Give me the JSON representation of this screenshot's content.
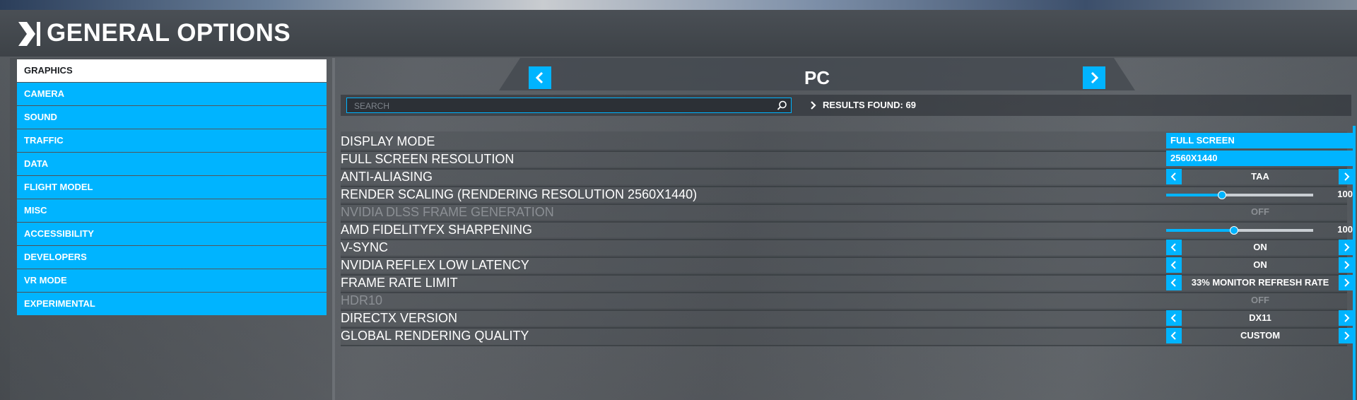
{
  "header": {
    "title": "GENERAL OPTIONS"
  },
  "sidebar": {
    "items": [
      {
        "label": "GRAPHICS",
        "active": true
      },
      {
        "label": "CAMERA"
      },
      {
        "label": "SOUND"
      },
      {
        "label": "TRAFFIC"
      },
      {
        "label": "DATA"
      },
      {
        "label": "FLIGHT MODEL"
      },
      {
        "label": "MISC"
      },
      {
        "label": "ACCESSIBILITY"
      },
      {
        "label": "DEVELOPERS"
      },
      {
        "label": "VR MODE"
      },
      {
        "label": "EXPERIMENTAL"
      }
    ]
  },
  "platform": {
    "title": "PC"
  },
  "search": {
    "placeholder": "SEARCH",
    "value": ""
  },
  "results": {
    "label": "RESULTS FOUND: 69"
  },
  "rows": [
    {
      "label": "DISPLAY MODE",
      "type": "dropdown",
      "value": "FULL SCREEN"
    },
    {
      "label": "FULL SCREEN RESOLUTION",
      "type": "dropdown",
      "value": "2560X1440"
    },
    {
      "label": "ANTI-ALIASING",
      "type": "selector",
      "value": "TAA"
    },
    {
      "label": "RENDER SCALING (RENDERING RESOLUTION 2560X1440)",
      "type": "slider",
      "value": "100",
      "fill_fraction": 0.38
    },
    {
      "label": "NVIDIA DLSS FRAME GENERATION",
      "type": "disabled",
      "value": "OFF"
    },
    {
      "label": "AMD FIDELITYFX SHARPENING",
      "type": "slider",
      "value": "100",
      "fill_fraction": 0.46
    },
    {
      "label": "V-SYNC",
      "type": "selector",
      "value": "ON"
    },
    {
      "label": "NVIDIA REFLEX LOW LATENCY",
      "type": "selector",
      "value": "ON"
    },
    {
      "label": "FRAME RATE LIMIT",
      "type": "selector",
      "value": "33% MONITOR REFRESH RATE"
    },
    {
      "label": "HDR10",
      "type": "disabled",
      "value": "OFF"
    },
    {
      "label": "DIRECTX VERSION",
      "type": "selector",
      "value": "DX11"
    },
    {
      "label": "GLOBAL RENDERING QUALITY",
      "type": "selector",
      "value": "CUSTOM"
    }
  ],
  "colors": {
    "accent": "#00b4ff",
    "active_tab_bg": "#ffffff",
    "disabled_text": "#8b8f94"
  },
  "icons": {
    "header": "chevron-right-icon",
    "search": "search-icon",
    "prev": "chevron-left-icon",
    "next": "chevron-right-icon"
  }
}
